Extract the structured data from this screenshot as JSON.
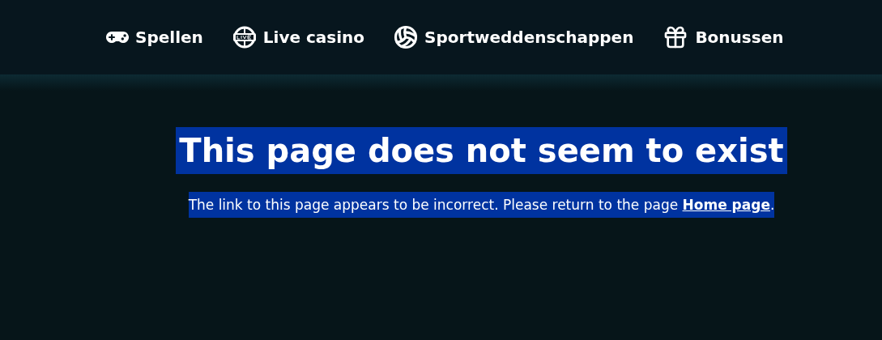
{
  "nav": [
    {
      "kind": "gamepad",
      "label": "Spellen"
    },
    {
      "kind": "live",
      "label": "Live casino"
    },
    {
      "kind": "ball",
      "label": "Sportweddenschappen"
    },
    {
      "kind": "gift",
      "label": "Bonussen"
    }
  ],
  "error": {
    "title": "This page does not seem to exist",
    "message_before": "The link to this page appears to be incorrect. Please return to the page ",
    "link": "Home page",
    "message_after": "."
  }
}
